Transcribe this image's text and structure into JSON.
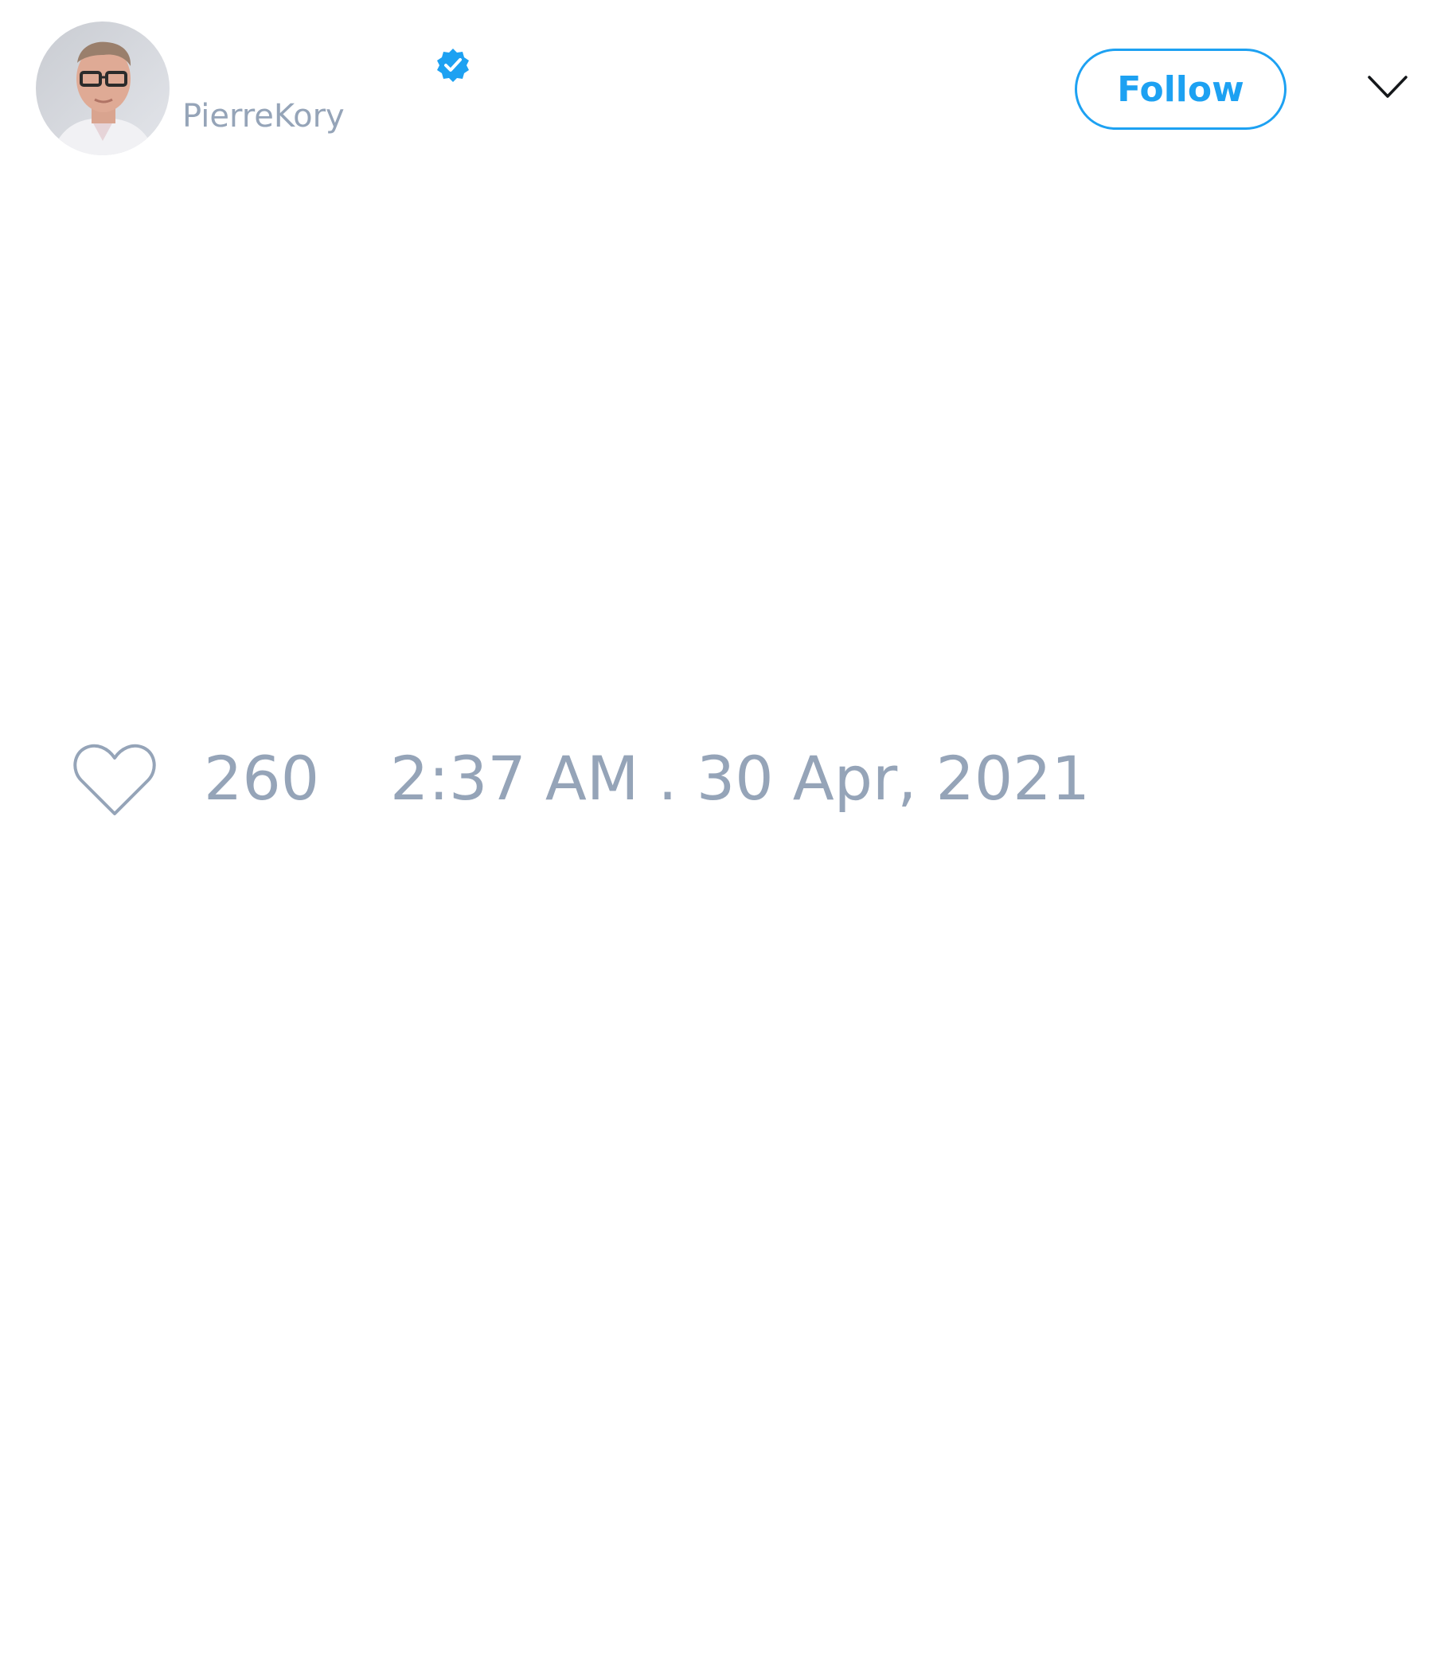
{
  "tweet": {
    "author": {
      "display_name": "",
      "handle": "PierreKory",
      "verified": true,
      "avatar_icon": "profile-photo"
    },
    "follow_label": "Follow",
    "menu_icon": "chevron-down-icon",
    "like_icon": "heart-icon",
    "like_count": "260",
    "timestamp": "2:37 AM . 30 Apr, 2021"
  },
  "colors": {
    "accent": "#1da1f2",
    "muted_text": "#95a4b8",
    "background": "#ffffff"
  }
}
